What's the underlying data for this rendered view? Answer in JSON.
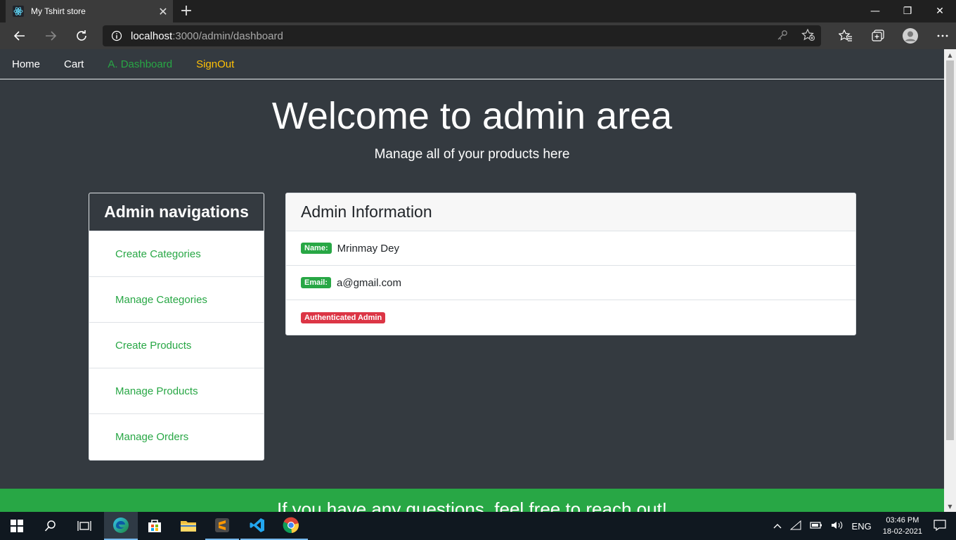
{
  "browser": {
    "tab_title": "My Tshirt store",
    "url_host": "localhost",
    "url_path": ":3000/admin/dashboard"
  },
  "navbar": {
    "home": "Home",
    "cart": "Cart",
    "dashboard": "A. Dashboard",
    "signout": "SignOut"
  },
  "hero": {
    "title": "Welcome to admin area",
    "subtitle": "Manage all of your products here"
  },
  "admin_nav": {
    "heading": "Admin navigations",
    "items": [
      {
        "label": "Create Categories"
      },
      {
        "label": "Manage Categories"
      },
      {
        "label": "Create Products"
      },
      {
        "label": "Manage Products"
      },
      {
        "label": "Manage Orders"
      }
    ]
  },
  "admin_info": {
    "heading": "Admin Information",
    "name_badge": "Name:",
    "name_value": "Mrinmay Dey",
    "email_badge": "Email:",
    "email_value": "a@gmail.com",
    "role_badge": "Authenticated Admin"
  },
  "footer": {
    "text": "If you have any questions, feel free to reach out!"
  },
  "taskbar": {
    "language": "ENG",
    "time": "03:46 PM",
    "date": "18-02-2021"
  },
  "colors": {
    "page_bg": "#343a40",
    "success": "#28a745",
    "warning": "#ffc107",
    "danger": "#dc3545"
  }
}
